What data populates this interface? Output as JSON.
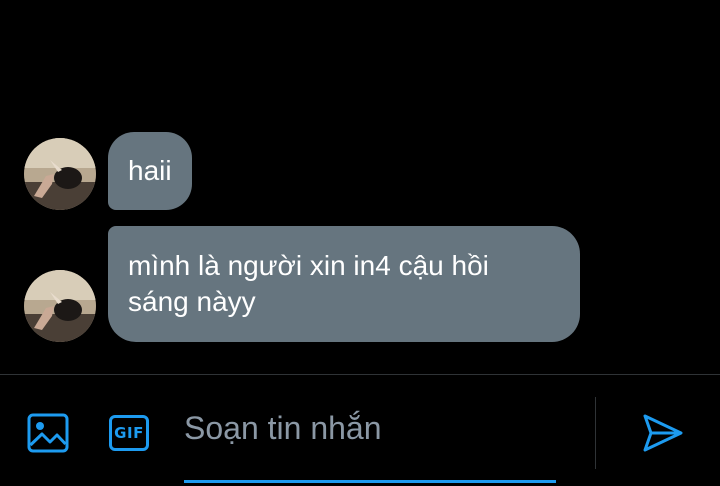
{
  "conversation": {
    "messages": [
      {
        "text": "haii"
      },
      {
        "text": "mình là người xin in4 cậu hồi\nsáng nàyy"
      }
    ]
  },
  "composer": {
    "placeholder": "Soạn tin nhắn",
    "gif_label": "GIF",
    "icons": {
      "image": "image-icon",
      "gif": "gif-icon",
      "send": "send-icon"
    }
  },
  "colors": {
    "background": "#000000",
    "bubble": "#66757f",
    "accent": "#1d9bf0",
    "placeholder": "#8b98a5",
    "divider": "#2f3336"
  }
}
